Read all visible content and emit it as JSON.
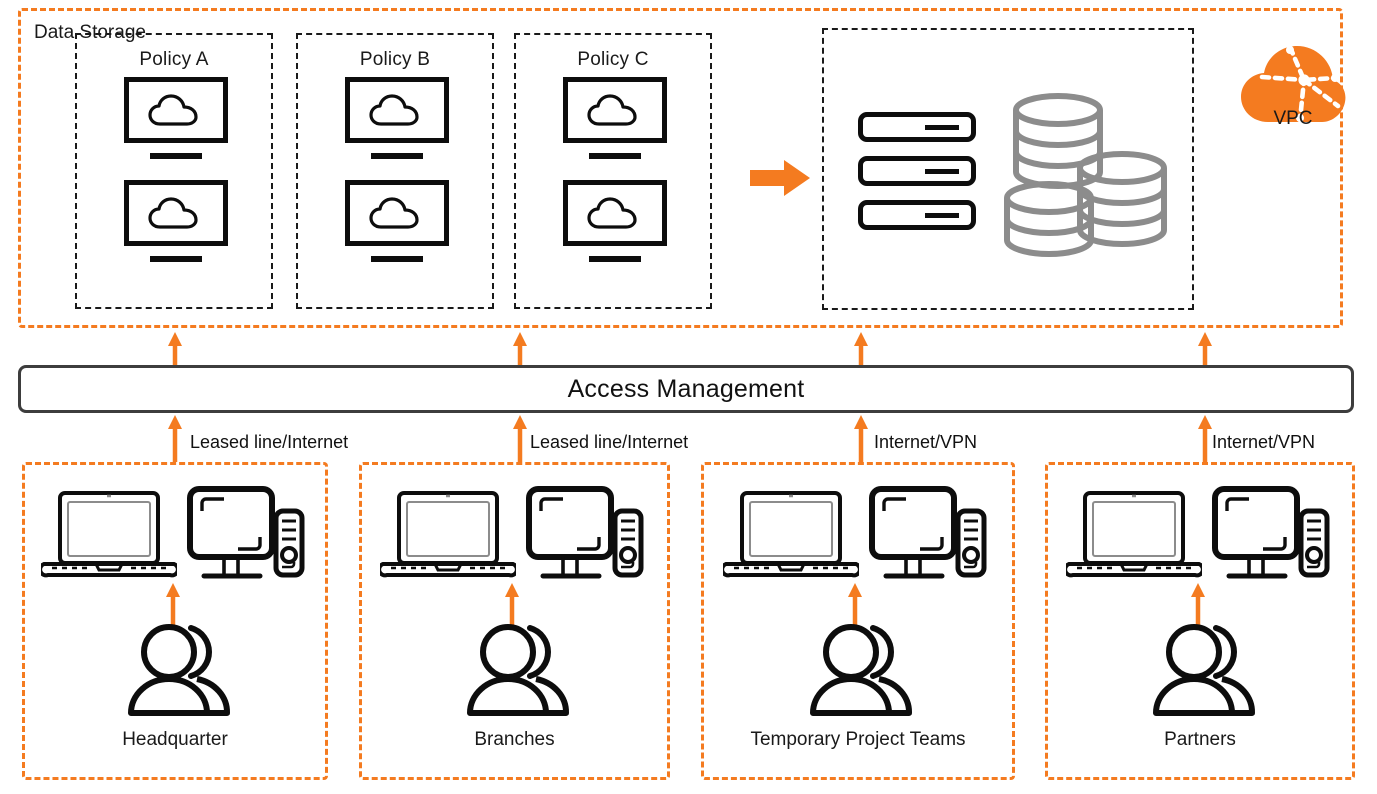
{
  "diagram": {
    "title": "VPC access management architecture",
    "colors": {
      "accent_orange": "#F47B20",
      "dark_line": "#1a1a1a",
      "storage_gray": "#8c8c8c",
      "bar_border": "#3d3d3d",
      "background": "#ffffff"
    }
  },
  "vpc": {
    "label": "VPC",
    "logo_icon": "cloud-network-icon"
  },
  "policies": [
    {
      "title": "Policy A",
      "icons": [
        "monitor-cloud-icon",
        "monitor-cloud-icon"
      ]
    },
    {
      "title": "Policy B",
      "icons": [
        "monitor-cloud-icon",
        "monitor-cloud-icon"
      ]
    },
    {
      "title": "Policy C",
      "icons": [
        "monitor-cloud-icon",
        "monitor-cloud-icon"
      ]
    }
  ],
  "storage": {
    "title": "Data Storage",
    "server_rack_units": 3,
    "database_cylinders": 3,
    "rack_icon": "server-rack-icon",
    "database_icon": "database-cylinder-icon"
  },
  "flow_arrow": {
    "icon": "right-arrow-icon",
    "from": "Policy C",
    "to": "Data Storage"
  },
  "access_management": {
    "label": "Access Management"
  },
  "connections": [
    {
      "label": "Leased line/Internet",
      "from": "Headquarter",
      "to": "Access Management"
    },
    {
      "label": "Leased line/Internet",
      "from": "Branches",
      "to": "Access Management"
    },
    {
      "label": "Internet/VPN",
      "from": "Temporary Project Teams",
      "to": "Access Management"
    },
    {
      "label": "Internet/VPN",
      "from": "Partners",
      "to": "Access Management"
    }
  ],
  "groups": [
    {
      "label": "Headquarter",
      "icons": [
        "laptop-icon",
        "desktop-computer-icon",
        "users-icon"
      ]
    },
    {
      "label": "Branches",
      "icons": [
        "laptop-icon",
        "desktop-computer-icon",
        "users-icon"
      ]
    },
    {
      "label": "Temporary Project Teams",
      "icons": [
        "laptop-icon",
        "desktop-computer-icon",
        "users-icon"
      ]
    },
    {
      "label": "Partners",
      "icons": [
        "laptop-icon",
        "desktop-computer-icon",
        "users-icon"
      ]
    }
  ]
}
